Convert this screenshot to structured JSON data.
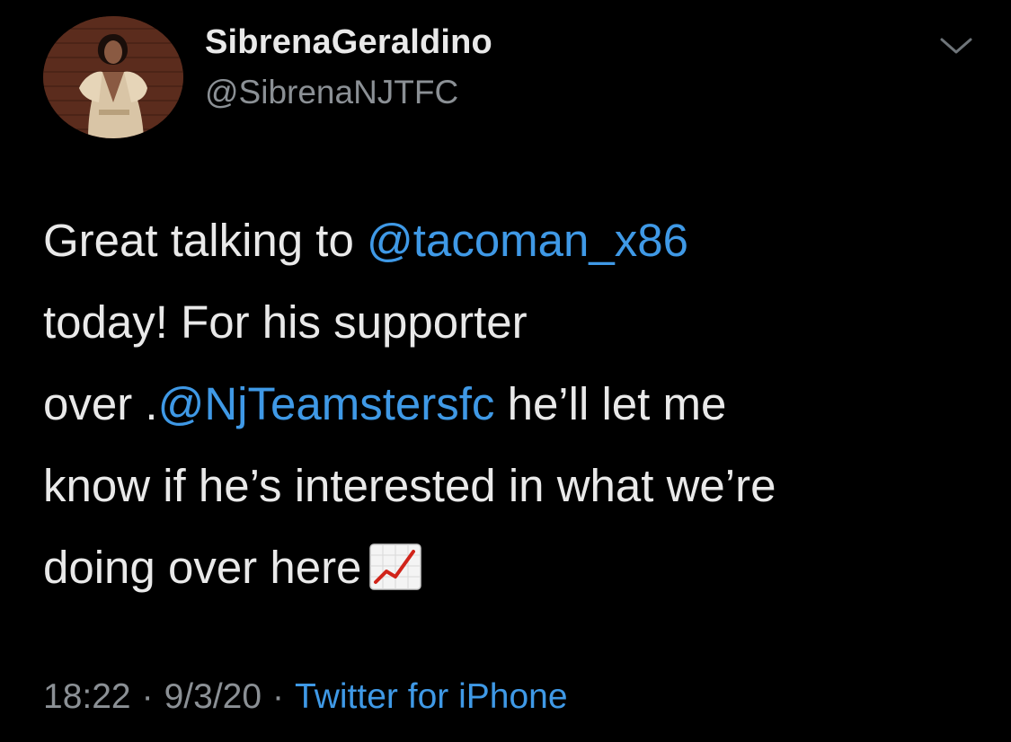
{
  "tweet": {
    "author": {
      "display_name": "SibrenaGeraldino",
      "handle": "@SibrenaNJTFC",
      "avatar_icon": "profile-photo"
    },
    "menu_icon": "chevron-down-icon",
    "text": {
      "line1_prefix": "Great talking to ",
      "mention1": "@tacoman_x86",
      "line2": "today! For his supporter",
      "line3_prefix": "over .",
      "mention2": "@NjTeamstersfc",
      "line3_suffix": " he’ll let me",
      "line4": "know if he’s interested in what we’re",
      "line5": "doing over here",
      "emoji": "chart-increasing-emoji"
    },
    "meta": {
      "time": "18:22",
      "separator": "·",
      "date": "9/3/20",
      "source": "Twitter for iPhone"
    }
  },
  "colors": {
    "background": "#000000",
    "text": "#e9e9e9",
    "secondary": "#8b9095",
    "link": "#3f99e6",
    "emoji_line": "#d1241a"
  }
}
